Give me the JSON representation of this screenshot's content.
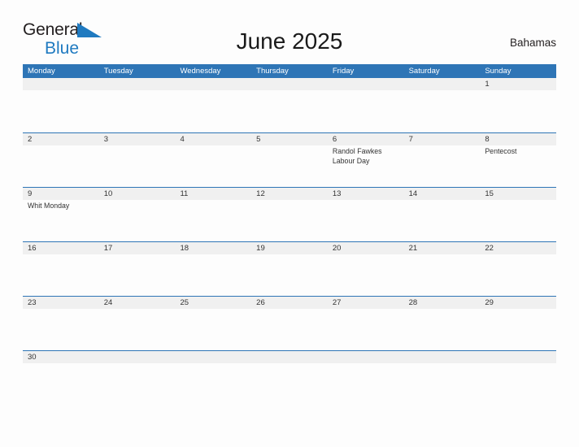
{
  "brand": {
    "name_part1": "General",
    "name_part2": "Blue",
    "flag_icon": "triangle-flag-icon",
    "color_dark": "#231f20",
    "color_blue": "#1f7ac0"
  },
  "header": {
    "title": "June 2025",
    "country": "Bahamas"
  },
  "theme": {
    "header_blue": "#2e75b6",
    "row_band_gray": "#f0f0f0",
    "page_background": "#fdfdfd",
    "text_color": "#333333"
  },
  "calendar": {
    "month": "June",
    "year": "2025",
    "weekday_headers": [
      "Monday",
      "Tuesday",
      "Wednesday",
      "Thursday",
      "Friday",
      "Saturday",
      "Sunday"
    ],
    "weeks": [
      {
        "days": [
          {
            "date": "",
            "events": []
          },
          {
            "date": "",
            "events": []
          },
          {
            "date": "",
            "events": []
          },
          {
            "date": "",
            "events": []
          },
          {
            "date": "",
            "events": []
          },
          {
            "date": "",
            "events": []
          },
          {
            "date": "1",
            "events": []
          }
        ]
      },
      {
        "days": [
          {
            "date": "2",
            "events": []
          },
          {
            "date": "3",
            "events": []
          },
          {
            "date": "4",
            "events": []
          },
          {
            "date": "5",
            "events": []
          },
          {
            "date": "6",
            "events": [
              "Randol Fawkes",
              "Labour Day"
            ]
          },
          {
            "date": "7",
            "events": []
          },
          {
            "date": "8",
            "events": [
              "Pentecost"
            ]
          }
        ]
      },
      {
        "days": [
          {
            "date": "9",
            "events": [
              "Whit Monday"
            ]
          },
          {
            "date": "10",
            "events": []
          },
          {
            "date": "11",
            "events": []
          },
          {
            "date": "12",
            "events": []
          },
          {
            "date": "13",
            "events": []
          },
          {
            "date": "14",
            "events": []
          },
          {
            "date": "15",
            "events": []
          }
        ]
      },
      {
        "days": [
          {
            "date": "16",
            "events": []
          },
          {
            "date": "17",
            "events": []
          },
          {
            "date": "18",
            "events": []
          },
          {
            "date": "19",
            "events": []
          },
          {
            "date": "20",
            "events": []
          },
          {
            "date": "21",
            "events": []
          },
          {
            "date": "22",
            "events": []
          }
        ]
      },
      {
        "days": [
          {
            "date": "23",
            "events": []
          },
          {
            "date": "24",
            "events": []
          },
          {
            "date": "25",
            "events": []
          },
          {
            "date": "26",
            "events": []
          },
          {
            "date": "27",
            "events": []
          },
          {
            "date": "28",
            "events": []
          },
          {
            "date": "29",
            "events": []
          }
        ]
      },
      {
        "days": [
          {
            "date": "30",
            "events": []
          },
          {
            "date": "",
            "events": []
          },
          {
            "date": "",
            "events": []
          },
          {
            "date": "",
            "events": []
          },
          {
            "date": "",
            "events": []
          },
          {
            "date": "",
            "events": []
          },
          {
            "date": "",
            "events": []
          }
        ]
      }
    ]
  }
}
